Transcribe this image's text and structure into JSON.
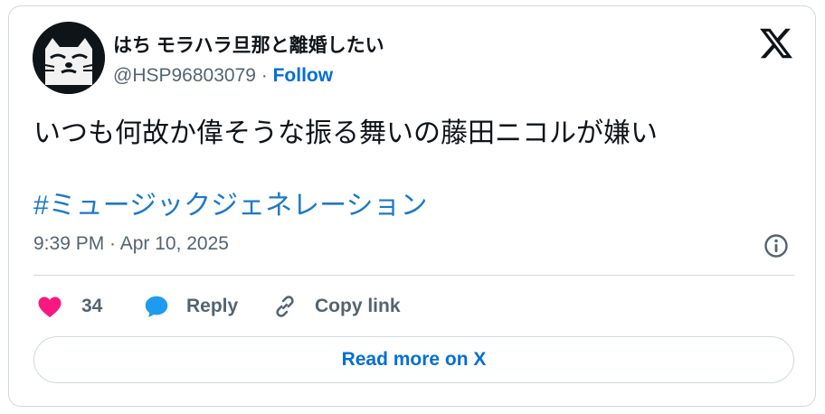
{
  "author": {
    "display_name": "はち モラハラ旦那と離婚したい",
    "handle": "@HSP96803079",
    "separator": " · ",
    "follow_label": "Follow"
  },
  "tweet": {
    "text": "いつも何故か偉そうな振る舞いの藤田ニコルが嫌い",
    "hashtag": "#ミュージックジェネレーション",
    "timestamp": "9:39 PM · Apr 10, 2025"
  },
  "actions": {
    "like_count": "34",
    "reply_label": "Reply",
    "copy_link_label": "Copy link"
  },
  "read_more_label": "Read more on X",
  "icons": {
    "avatar": "cat-face-avatar",
    "brand": "x-logo-icon",
    "info": "info-icon",
    "like": "heart-icon",
    "reply": "speech-bubble-icon",
    "copy": "link-icon"
  },
  "colors": {
    "text": "#0f1419",
    "secondary": "#536471",
    "link": "#006fd6",
    "hashtag": "#1d79c6",
    "like": "#f91880",
    "reply": "#1d9bf0",
    "border": "#cfd9de"
  }
}
